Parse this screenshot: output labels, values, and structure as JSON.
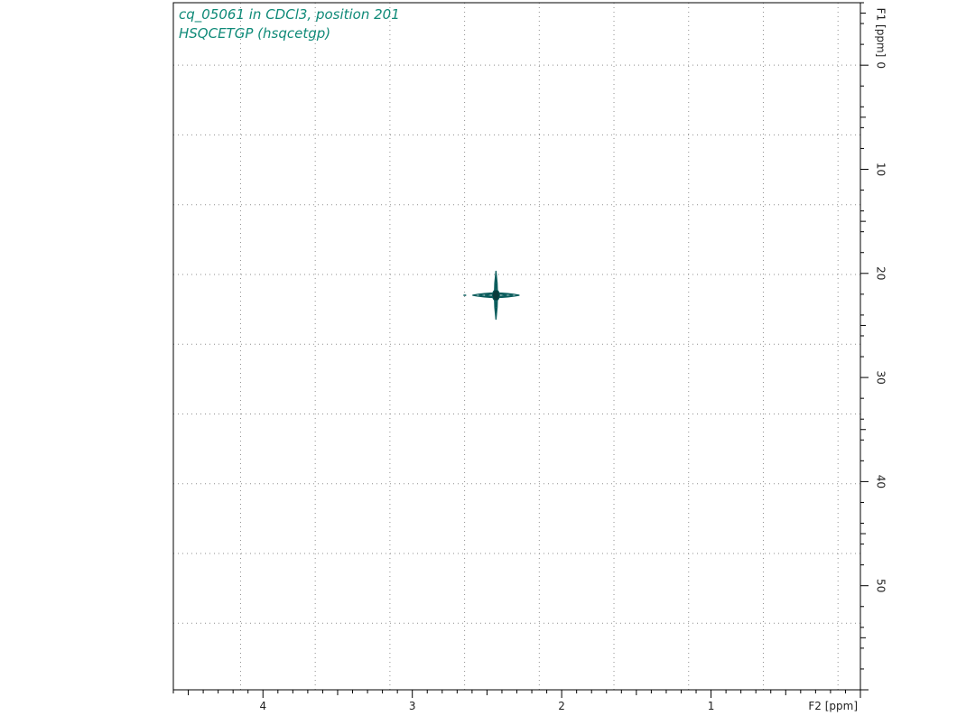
{
  "chart_data": {
    "type": "contour",
    "annotations": [
      "cq_05061 in CDCl3, position 201",
      "HSQCETGP (hsqcetgp)"
    ],
    "xlabel": "F2 [ppm]",
    "ylabel": "F1 [ppm]",
    "xlim": [
      4.6,
      0.0
    ],
    "ylim": [
      -6.0,
      60.0
    ],
    "x_ticks": [
      4,
      3,
      2,
      1
    ],
    "y_ticks": [
      0,
      10,
      20,
      30,
      40,
      50
    ],
    "x_grid": [
      4.15,
      3.65,
      3.15,
      2.65,
      2.15,
      1.65,
      1.15,
      0.65,
      0.15
    ],
    "y_grid": [
      0,
      6.7,
      13.4,
      20.1,
      26.8,
      33.5,
      40.2,
      46.9,
      53.6
    ],
    "grid": true,
    "peaks": [
      {
        "f2": 2.44,
        "f1": 22.1
      }
    ],
    "contour_color": "#0a5c5c",
    "annotation_color": "#0f8a78"
  }
}
